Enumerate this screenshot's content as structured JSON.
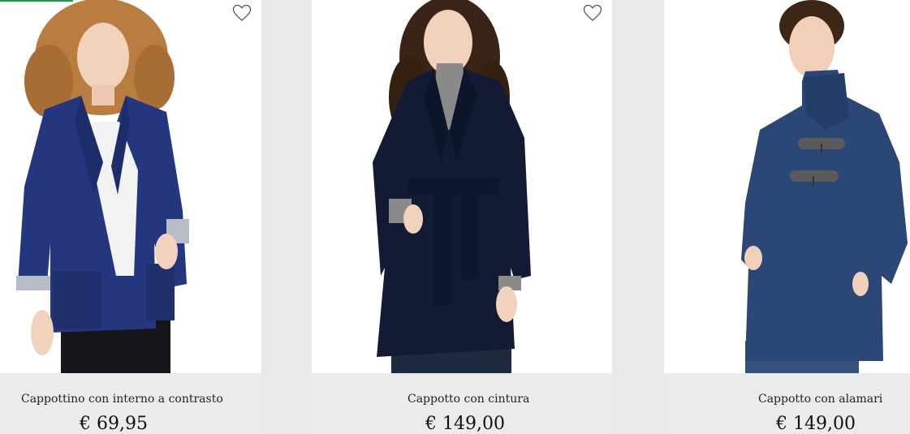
{
  "products": [
    {
      "name": "Cappottino con interno a contrasto",
      "price": "€ 69,95",
      "wishlist_icon": "heart-outline-icon",
      "image_description_icon": "jacket-photo"
    },
    {
      "name": "Cappotto con cintura",
      "price": "€ 149,00",
      "wishlist_icon": "heart-outline-icon",
      "image_description_icon": "coat-photo"
    },
    {
      "name": "Cappotto con alamari",
      "price": "€ 149,00",
      "image_description_icon": "duffle-coat-photo"
    }
  ],
  "colors": {
    "accent": "#1a9a3a",
    "card_background": "#ebebeb",
    "image_background": "#ffffff"
  }
}
